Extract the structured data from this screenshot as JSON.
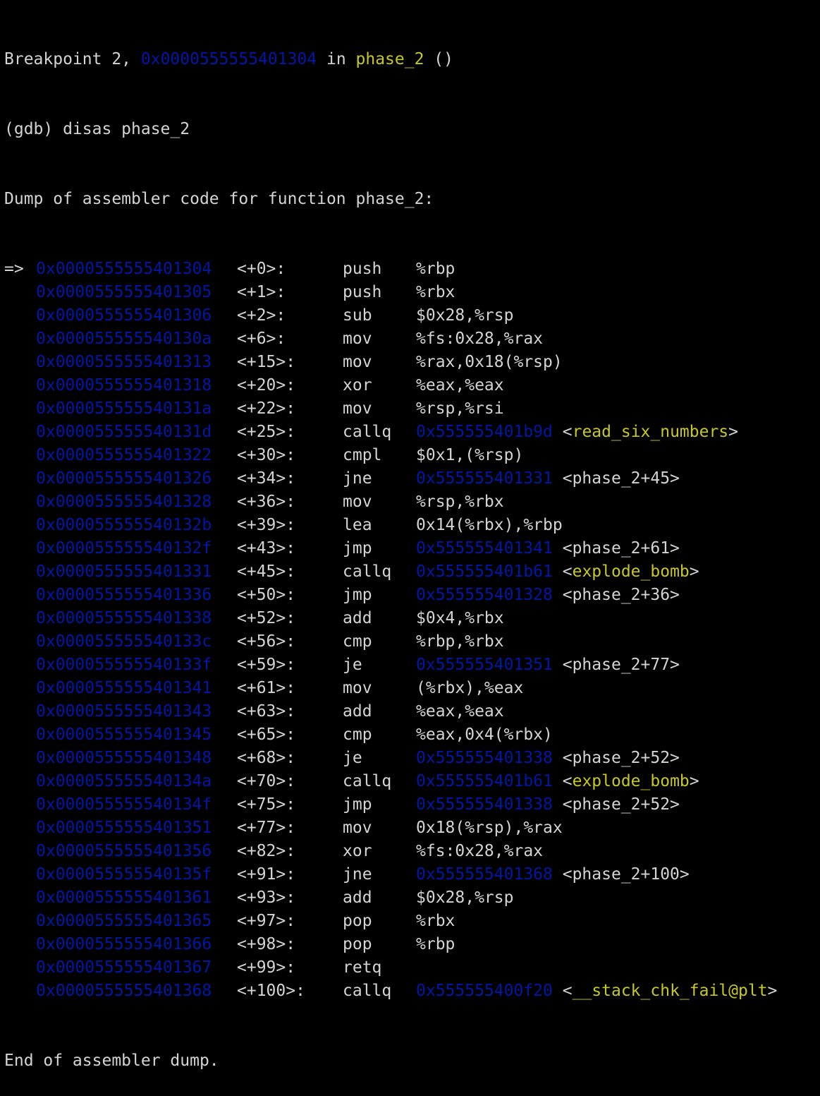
{
  "colors": {
    "background": "#000000",
    "text": "#d4d4d4",
    "address": "#0018a8",
    "symbol": "#c8c820"
  },
  "header": {
    "breakpoint_prefix": "Breakpoint 2, ",
    "breakpoint_addr": "0x0000555555401304",
    "breakpoint_in": " in ",
    "breakpoint_func": "phase_2",
    "breakpoint_suffix": " ()",
    "command": "(gdb) disas phase_2",
    "dump_title": "Dump of assembler code for function phase_2:"
  },
  "lines": [
    {
      "marker": "=>",
      "addr": "0x0000555555401304",
      "off": "<+0>:",
      "mn": "push",
      "op": "%rbp",
      "tgt": "",
      "sym": ""
    },
    {
      "marker": "",
      "addr": "0x0000555555401305",
      "off": "<+1>:",
      "mn": "push",
      "op": "%rbx",
      "tgt": "",
      "sym": ""
    },
    {
      "marker": "",
      "addr": "0x0000555555401306",
      "off": "<+2>:",
      "mn": "sub",
      "op": "$0x28,%rsp",
      "tgt": "",
      "sym": ""
    },
    {
      "marker": "",
      "addr": "0x000055555540130a",
      "off": "<+6>:",
      "mn": "mov",
      "op": "%fs:0x28,%rax",
      "tgt": "",
      "sym": ""
    },
    {
      "marker": "",
      "addr": "0x0000555555401313",
      "off": "<+15>:",
      "mn": "mov",
      "op": "%rax,0x18(%rsp)",
      "tgt": "",
      "sym": ""
    },
    {
      "marker": "",
      "addr": "0x0000555555401318",
      "off": "<+20>:",
      "mn": "xor",
      "op": "%eax,%eax",
      "tgt": "",
      "sym": ""
    },
    {
      "marker": "",
      "addr": "0x000055555540131a",
      "off": "<+22>:",
      "mn": "mov",
      "op": "%rsp,%rsi",
      "tgt": "",
      "sym": ""
    },
    {
      "marker": "",
      "addr": "0x000055555540131d",
      "off": "<+25>:",
      "mn": "callq",
      "op": "",
      "tgt": "0x555555401b9d",
      "sym": "<read_six_numbers>"
    },
    {
      "marker": "",
      "addr": "0x0000555555401322",
      "off": "<+30>:",
      "mn": "cmpl",
      "op": "$0x1,(%rsp)",
      "tgt": "",
      "sym": ""
    },
    {
      "marker": "",
      "addr": "0x0000555555401326",
      "off": "<+34>:",
      "mn": "jne",
      "op": "",
      "tgt": "0x555555401331",
      "sym": "<phase_2+45>"
    },
    {
      "marker": "",
      "addr": "0x0000555555401328",
      "off": "<+36>:",
      "mn": "mov",
      "op": "%rsp,%rbx",
      "tgt": "",
      "sym": ""
    },
    {
      "marker": "",
      "addr": "0x000055555540132b",
      "off": "<+39>:",
      "mn": "lea",
      "op": "0x14(%rbx),%rbp",
      "tgt": "",
      "sym": ""
    },
    {
      "marker": "",
      "addr": "0x000055555540132f",
      "off": "<+43>:",
      "mn": "jmp",
      "op": "",
      "tgt": "0x555555401341",
      "sym": "<phase_2+61>"
    },
    {
      "marker": "",
      "addr": "0x0000555555401331",
      "off": "<+45>:",
      "mn": "callq",
      "op": "",
      "tgt": "0x555555401b61",
      "sym": "<explode_bomb>"
    },
    {
      "marker": "",
      "addr": "0x0000555555401336",
      "off": "<+50>:",
      "mn": "jmp",
      "op": "",
      "tgt": "0x555555401328",
      "sym": "<phase_2+36>"
    },
    {
      "marker": "",
      "addr": "0x0000555555401338",
      "off": "<+52>:",
      "mn": "add",
      "op": "$0x4,%rbx",
      "tgt": "",
      "sym": ""
    },
    {
      "marker": "",
      "addr": "0x000055555540133c",
      "off": "<+56>:",
      "mn": "cmp",
      "op": "%rbp,%rbx",
      "tgt": "",
      "sym": ""
    },
    {
      "marker": "",
      "addr": "0x000055555540133f",
      "off": "<+59>:",
      "mn": "je",
      "op": "",
      "tgt": "0x555555401351",
      "sym": "<phase_2+77>"
    },
    {
      "marker": "",
      "addr": "0x0000555555401341",
      "off": "<+61>:",
      "mn": "mov",
      "op": "(%rbx),%eax",
      "tgt": "",
      "sym": ""
    },
    {
      "marker": "",
      "addr": "0x0000555555401343",
      "off": "<+63>:",
      "mn": "add",
      "op": "%eax,%eax",
      "tgt": "",
      "sym": ""
    },
    {
      "marker": "",
      "addr": "0x0000555555401345",
      "off": "<+65>:",
      "mn": "cmp",
      "op": "%eax,0x4(%rbx)",
      "tgt": "",
      "sym": ""
    },
    {
      "marker": "",
      "addr": "0x0000555555401348",
      "off": "<+68>:",
      "mn": "je",
      "op": "",
      "tgt": "0x555555401338",
      "sym": "<phase_2+52>"
    },
    {
      "marker": "",
      "addr": "0x000055555540134a",
      "off": "<+70>:",
      "mn": "callq",
      "op": "",
      "tgt": "0x555555401b61",
      "sym": "<explode_bomb>"
    },
    {
      "marker": "",
      "addr": "0x000055555540134f",
      "off": "<+75>:",
      "mn": "jmp",
      "op": "",
      "tgt": "0x555555401338",
      "sym": "<phase_2+52>"
    },
    {
      "marker": "",
      "addr": "0x0000555555401351",
      "off": "<+77>:",
      "mn": "mov",
      "op": "0x18(%rsp),%rax",
      "tgt": "",
      "sym": ""
    },
    {
      "marker": "",
      "addr": "0x0000555555401356",
      "off": "<+82>:",
      "mn": "xor",
      "op": "%fs:0x28,%rax",
      "tgt": "",
      "sym": ""
    },
    {
      "marker": "",
      "addr": "0x000055555540135f",
      "off": "<+91>:",
      "mn": "jne",
      "op": "",
      "tgt": "0x555555401368",
      "sym": "<phase_2+100>"
    },
    {
      "marker": "",
      "addr": "0x0000555555401361",
      "off": "<+93>:",
      "mn": "add",
      "op": "$0x28,%rsp",
      "tgt": "",
      "sym": ""
    },
    {
      "marker": "",
      "addr": "0x0000555555401365",
      "off": "<+97>:",
      "mn": "pop",
      "op": "%rbx",
      "tgt": "",
      "sym": ""
    },
    {
      "marker": "",
      "addr": "0x0000555555401366",
      "off": "<+98>:",
      "mn": "pop",
      "op": "%rbp",
      "tgt": "",
      "sym": ""
    },
    {
      "marker": "",
      "addr": "0x0000555555401367",
      "off": "<+99>:",
      "mn": "retq",
      "op": "",
      "tgt": "",
      "sym": ""
    },
    {
      "marker": "",
      "addr": "0x0000555555401368",
      "off": "<+100>:",
      "mn": "callq",
      "op": "",
      "tgt": "0x555555400f20",
      "sym": "<__stack_chk_fail@plt>"
    }
  ],
  "footer": "End of assembler dump."
}
